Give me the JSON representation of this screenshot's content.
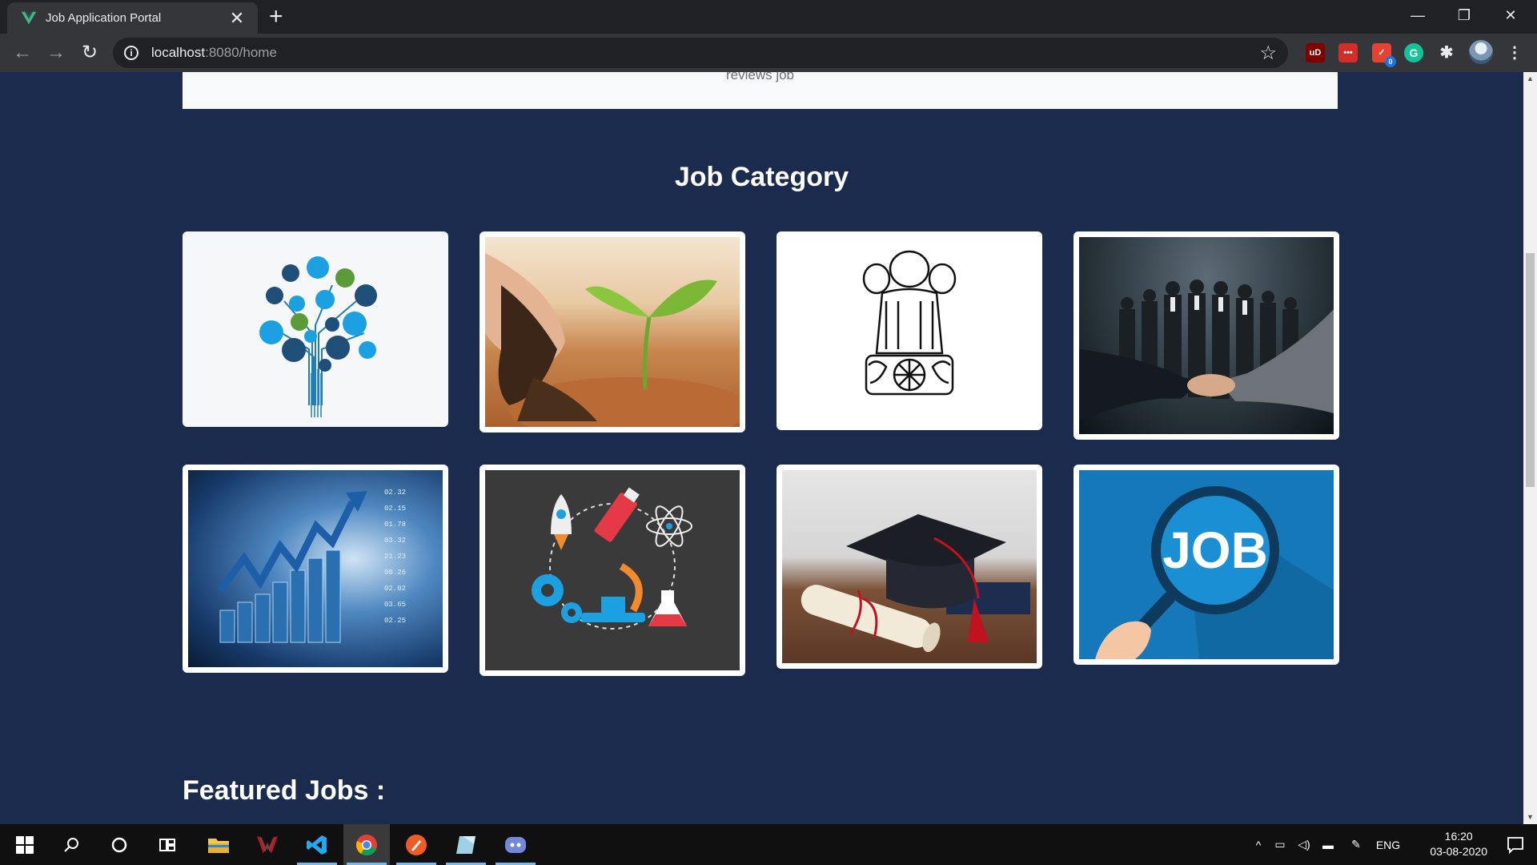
{
  "browser": {
    "tab_title": "Job Application Portal",
    "tab_close": "✕",
    "new_tab": "+",
    "url_host": "localhost",
    "url_path": ":8080/home",
    "window_controls": {
      "minimize": "—",
      "restore": "❐",
      "close": "✕"
    },
    "extensions": [
      {
        "name": "ublock-icon",
        "label": "uD",
        "color": "#800000"
      },
      {
        "name": "lastpass-icon",
        "label": "•••",
        "color": "#d32d27"
      },
      {
        "name": "todoist-icon",
        "label": "✓",
        "color": "#e44332",
        "badge": "0"
      },
      {
        "name": "grammarly-icon",
        "label": "G",
        "color": "#15c39a"
      }
    ]
  },
  "page": {
    "top_card_text": "reviews job",
    "section_title": "Job Category",
    "featured_title": "Featured Jobs :",
    "categories": [
      {
        "name": "category-it",
        "image": "technology-tree-image"
      },
      {
        "name": "category-agriculture",
        "image": "seedling-soil-image"
      },
      {
        "name": "category-government",
        "image": "national-emblem-image"
      },
      {
        "name": "category-business",
        "image": "handshake-team-image"
      },
      {
        "name": "category-finance",
        "image": "stock-chart-image"
      },
      {
        "name": "category-science",
        "image": "science-tools-image"
      },
      {
        "name": "category-education",
        "image": "graduation-cap-image"
      },
      {
        "name": "category-jobs",
        "image": "job-magnifier-image"
      }
    ],
    "job_logo_text": "JOB"
  },
  "taskbar": {
    "language": "ENG",
    "time": "16:20",
    "date": "03-08-2020"
  },
  "colors": {
    "page_bg": "#1a2b4e",
    "card_bg": "#ffffff",
    "accent": "#76b9ed"
  }
}
